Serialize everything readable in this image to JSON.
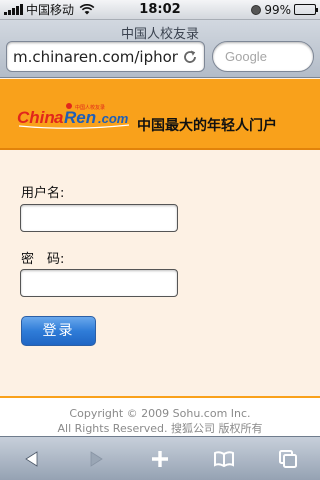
{
  "status_bar": {
    "carrier": "中国移动",
    "time": "18:02",
    "battery": "99%",
    "battery_level": 0.99
  },
  "browser": {
    "page_title": "中国人校友录",
    "url": "m.chinaren.com/iphon…",
    "search_placeholder": "Google"
  },
  "banner": {
    "logo_text": "ChinaRen.com",
    "logo_subtext": "中国人校友录",
    "slogan": "中国最大的年轻人门户"
  },
  "login_form": {
    "username_label": "用户名:",
    "password_label": "密　码:",
    "username_value": "",
    "password_value": "",
    "submit_label": "登录"
  },
  "footer": {
    "line1": "Copyright © 2009 Sohu.com Inc.",
    "line2": "All Rights Reserved. 搜狐公司 版权所有"
  },
  "toolbar": {
    "icons": [
      "back-icon",
      "forward-icon",
      "add-icon",
      "bookmarks-icon",
      "pages-icon"
    ]
  },
  "colors": {
    "banner_orange": "#f9a11b",
    "form_background": "#fdf1e4",
    "button_blue": "#2f7cd8",
    "logo_red": "#e1261c"
  }
}
